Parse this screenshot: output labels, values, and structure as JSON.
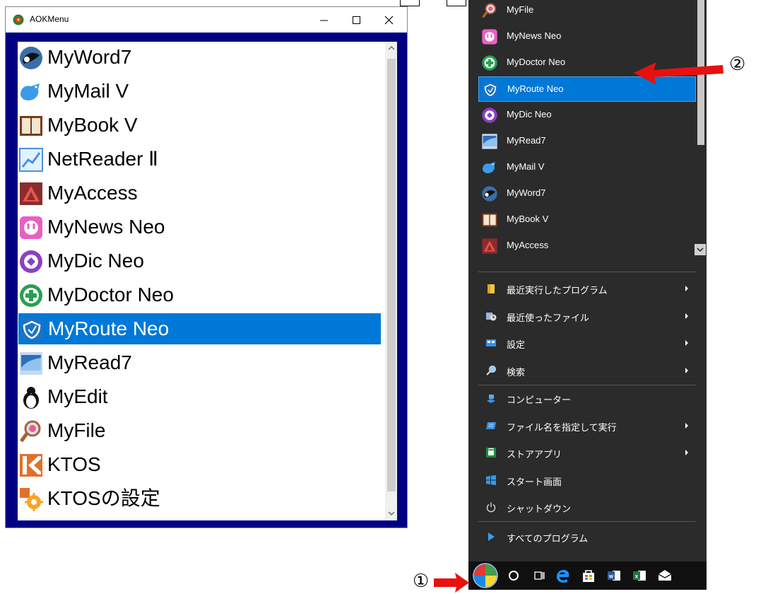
{
  "aok_window": {
    "title": "AOKMenu",
    "items": [
      {
        "label": "MyWord7",
        "icon": "myword7-icon"
      },
      {
        "label": "MyMail V",
        "icon": "mymail-icon"
      },
      {
        "label": "MyBook V",
        "icon": "mybook-icon"
      },
      {
        "label": "NetReader Ⅱ",
        "icon": "netreader-icon"
      },
      {
        "label": "MyAccess",
        "icon": "myaccess-icon"
      },
      {
        "label": "MyNews Neo",
        "icon": "mynews-icon"
      },
      {
        "label": "MyDic Neo",
        "icon": "mydic-icon"
      },
      {
        "label": "MyDoctor Neo",
        "icon": "mydoctor-icon"
      },
      {
        "label": "MyRoute Neo",
        "icon": "myroute-icon",
        "selected": true
      },
      {
        "label": "MyRead7",
        "icon": "myread7-icon"
      },
      {
        "label": "MyEdit",
        "icon": "myedit-icon"
      },
      {
        "label": "MyFile",
        "icon": "myfile-icon"
      },
      {
        "label": "KTOS",
        "icon": "ktos-icon"
      },
      {
        "label": "KTOSの設定",
        "icon": "ktos-settings-icon"
      }
    ]
  },
  "start_menu": {
    "programs": [
      {
        "label": "MyFile",
        "icon": "myfile-icon"
      },
      {
        "label": "MyNews Neo",
        "icon": "mynews-icon"
      },
      {
        "label": "MyDoctor Neo",
        "icon": "mydoctor-icon"
      },
      {
        "label": "MyRoute Neo",
        "icon": "myroute-icon",
        "selected": true
      },
      {
        "label": "MyDic Neo",
        "icon": "mydic-icon"
      },
      {
        "label": "MyRead7",
        "icon": "myread7-icon"
      },
      {
        "label": "MyMail V",
        "icon": "mymail-icon"
      },
      {
        "label": "MyWord7",
        "icon": "myword7-icon"
      },
      {
        "label": "MyBook V",
        "icon": "mybook-icon"
      },
      {
        "label": "MyAccess",
        "icon": "myaccess-icon"
      }
    ],
    "system": [
      {
        "label": "最近実行したプログラム",
        "icon": "folder-icon",
        "arrow": true
      },
      {
        "label": "最近使ったファイル",
        "icon": "recent-files-icon",
        "arrow": true
      },
      {
        "label": "設定",
        "icon": "settings-icon",
        "arrow": true
      },
      {
        "label": "検索",
        "icon": "search-icon",
        "arrow": true
      }
    ],
    "system2": [
      {
        "label": "コンピューター",
        "icon": "computer-icon",
        "arrow": false
      },
      {
        "label": "ファイル名を指定して実行",
        "icon": "run-icon",
        "arrow": true
      },
      {
        "label": "ストアアプリ",
        "icon": "store-icon",
        "arrow": true
      },
      {
        "label": "スタート画面",
        "icon": "windows-logo-icon",
        "arrow": false
      },
      {
        "label": "シャットダウン",
        "icon": "power-icon",
        "arrow": false
      }
    ],
    "all_programs": "すべてのプログラム"
  },
  "annotations": {
    "one": "①",
    "two": "②"
  },
  "colors": {
    "selection": "#0078d7",
    "frame": "#000082",
    "start_bg": "#2b2b2b",
    "arrow": "#e81010"
  }
}
